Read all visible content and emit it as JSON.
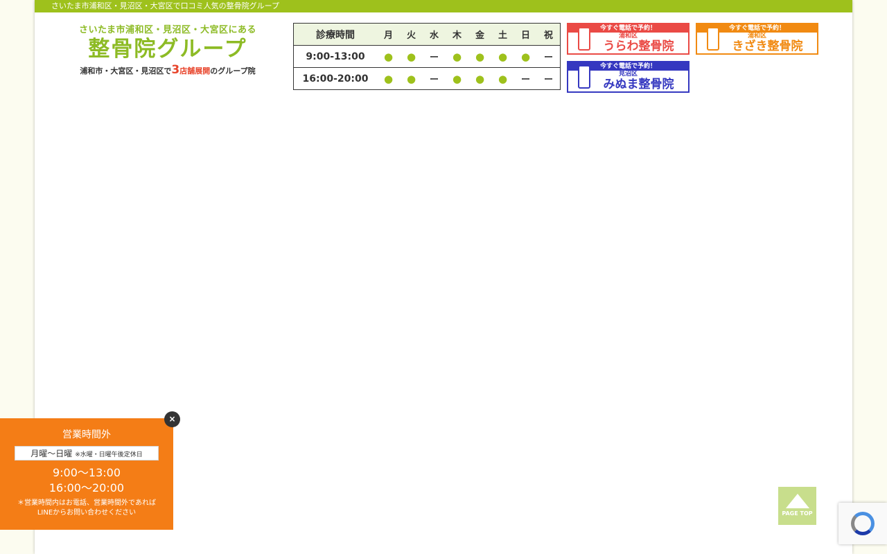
{
  "topbar": {
    "text": "さいたま市浦和区・見沼区・大宮区で口コミ人気の整骨院グループ"
  },
  "logo": {
    "subtitle": "さいたま市浦和区・見沼区・大宮区にある",
    "title": "整骨院グループ",
    "tag_pre": "浦和市・大宮区・見沼区で",
    "tag_num": "3",
    "tag_red": "店舗展開",
    "tag_post": "のグループ院"
  },
  "hours_table": {
    "header": [
      "診療時間",
      "月",
      "火",
      "水",
      "木",
      "金",
      "土",
      "日",
      "祝"
    ],
    "rows": [
      {
        "time": "9:00-13:00",
        "marks": [
          "●",
          "●",
          "ー",
          "●",
          "●",
          "●",
          "●",
          "ー"
        ]
      },
      {
        "time": "16:00-20:00",
        "marks": [
          "●",
          "●",
          "ー",
          "●",
          "●",
          "●",
          "ー",
          "ー"
        ]
      }
    ]
  },
  "tel_buttons": [
    {
      "band": "今すぐ電話で予約！",
      "area": "浦和区",
      "name": "うらわ整骨院",
      "color": "#ea4a45"
    },
    {
      "band": "今すぐ電話で予約！",
      "area": "浦和区",
      "name": "きざき整骨院",
      "color": "#f18a12"
    },
    {
      "band": "今すぐ電話で予約！",
      "area": "見沼区",
      "name": "みぬま整骨院",
      "color": "#3538c0"
    }
  ],
  "popup": {
    "close": "×",
    "title": "営業時間外",
    "days": "月曜〜日曜",
    "days_note": "※水曜・日曜午後定休日",
    "time1": "9:00〜13:00",
    "time2": "16:00〜20:00",
    "note": "＊営業時間内はお電話、営業時間外であればLINEからお問い合わせください",
    "bg_color": "#f47d16"
  },
  "pagetop": {
    "label": "PAGE TOP"
  },
  "colors": {
    "brand_green": "#9ec11c",
    "dot_green": "#9ec11c"
  },
  "icons": {
    "recaptcha": "recaptcha-icon",
    "phone": "phone-icon",
    "arrow_up": "arrow-up-icon"
  }
}
